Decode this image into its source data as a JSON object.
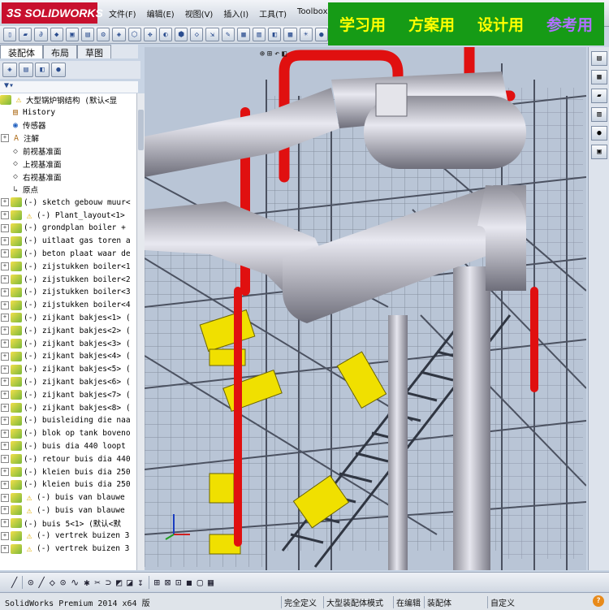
{
  "app": {
    "logo_mark": "3S",
    "logo_text": "SOLIDWORKS"
  },
  "menu": [
    "文件(F)",
    "编辑(E)",
    "视图(V)",
    "插入(I)",
    "工具(T)",
    "Toolbox"
  ],
  "banner": {
    "items": [
      "学习用",
      "方案用",
      "设计用",
      "参考用"
    ]
  },
  "panel_tabs": [
    "装配体",
    "布局",
    "草图"
  ],
  "tree": {
    "root": "大型锅炉钢结构  (默认<显",
    "items": [
      {
        "label": "History",
        "type": "history"
      },
      {
        "label": "传感器",
        "type": "sensor"
      },
      {
        "label": "注解",
        "type": "note"
      },
      {
        "label": "前视基准面",
        "type": "plane"
      },
      {
        "label": "上视基准面",
        "type": "plane"
      },
      {
        "label": "右视基准面",
        "type": "plane"
      },
      {
        "label": "原点",
        "type": "origin"
      },
      {
        "label": "(-) sketch gebouw muur<",
        "type": "part"
      },
      {
        "label": "(-) Plant_layout<1>",
        "type": "warn"
      },
      {
        "label": "(-) grondplan boiler +",
        "type": "part"
      },
      {
        "label": "(-) uitlaat gas toren a",
        "type": "part"
      },
      {
        "label": "(-) beton plaat waar de",
        "type": "part"
      },
      {
        "label": "(-) zijstukken boiler<1",
        "type": "part"
      },
      {
        "label": "(-) zijstukken boiler<2",
        "type": "part"
      },
      {
        "label": "(-) zijstukken boiler<3",
        "type": "part"
      },
      {
        "label": "(-) zijstukken boiler<4",
        "type": "part"
      },
      {
        "label": "(-) zijkant bakjes<1> (",
        "type": "part"
      },
      {
        "label": "(-) zijkant bakjes<2> (",
        "type": "part"
      },
      {
        "label": "(-) zijkant bakjes<3> (",
        "type": "part"
      },
      {
        "label": "(-) zijkant bakjes<4> (",
        "type": "part"
      },
      {
        "label": "(-) zijkant bakjes<5> (",
        "type": "part"
      },
      {
        "label": "(-) zijkant bakjes<6> (",
        "type": "part"
      },
      {
        "label": "(-) zijkant bakjes<7> (",
        "type": "part"
      },
      {
        "label": "(-) zijkant bakjes<8> (",
        "type": "part"
      },
      {
        "label": "(-) buisleiding die naa",
        "type": "part"
      },
      {
        "label": "(-) blok op tank boveno",
        "type": "part"
      },
      {
        "label": "(-) buis dia 440 loopt",
        "type": "part"
      },
      {
        "label": "(-) retour buis dia 440",
        "type": "part"
      },
      {
        "label": "(-) kleien buis dia 250",
        "type": "part"
      },
      {
        "label": "(-) kleien buis dia 250",
        "type": "part"
      },
      {
        "label": "(-) buis van blauwe",
        "type": "warn"
      },
      {
        "label": "(-) buis van blauwe",
        "type": "warn"
      },
      {
        "label": "(-) buis 5<1> (默认<默",
        "type": "part"
      },
      {
        "label": "(-) vertrek buizen 3",
        "type": "warn"
      },
      {
        "label": "(-) vertrek buizen 3",
        "type": "warn"
      }
    ]
  },
  "status": {
    "app_version": "SolidWorks Premium 2014 x64 版",
    "cells": [
      "完全定义",
      "大型装配体模式",
      "在编辑",
      "装配体",
      "自定义"
    ]
  },
  "colors": {
    "banner_bg": "#169b16",
    "banner_text": "#ffff00",
    "banner_accent": "#b070ff",
    "logo_bg": "#c8102e",
    "pipe_red": "#e01010",
    "pipe_grey": "#b4b4bc",
    "equipment_yellow": "#f0e000"
  }
}
